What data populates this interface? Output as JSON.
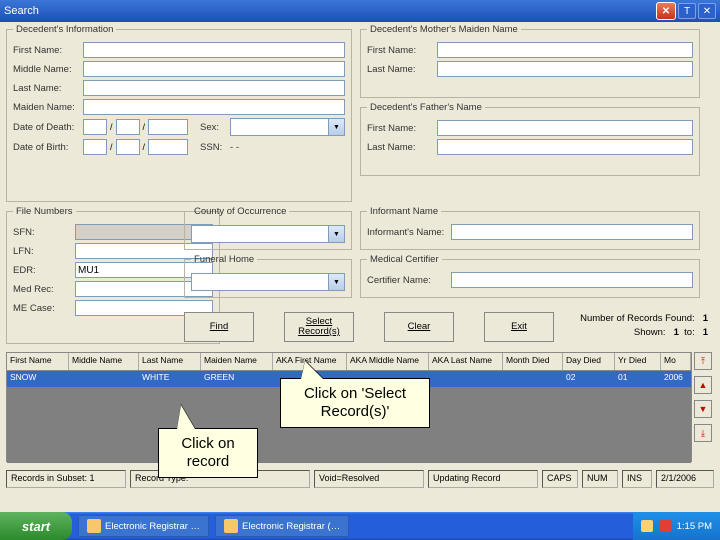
{
  "window": {
    "title": "Search"
  },
  "decedent": {
    "legend": "Decedent's Information",
    "first": "First Name:",
    "middle": "Middle Name:",
    "last": "Last Name:",
    "maiden": "Maiden Name:",
    "dod": "Date of Death:",
    "dob": "Date of Birth:",
    "sex": "Sex:",
    "ssn": "SSN:",
    "ssn_sep": "- -"
  },
  "mother": {
    "legend": "Decedent's Mother's Maiden Name",
    "first": "First Name:",
    "last": "Last Name:"
  },
  "father": {
    "legend": "Decedent's Father's Name",
    "first": "First Name:",
    "last": "Last Name:"
  },
  "filenum": {
    "legend": "File Numbers",
    "sfn": "SFN:",
    "lfn": "LFN:",
    "edr": "EDR:",
    "edr_val": "MU1",
    "medrec": "Med Rec:",
    "mecase": "ME Case:"
  },
  "county": {
    "legend": "County of Occurrence"
  },
  "funeral": {
    "legend": "Funeral Home"
  },
  "informant": {
    "legend": "Informant Name",
    "label": "Informant's Name:"
  },
  "medical": {
    "legend": "Medical Certifier",
    "label": "Certifier Name:"
  },
  "buttons": {
    "find": "Find",
    "select": "Select Record(s)",
    "clear": "Clear",
    "exit": "Exit"
  },
  "stats": {
    "found_lbl": "Number of Records Found:",
    "found": "1",
    "shown_lbl": "Shown:",
    "shown_from": "1",
    "to_lbl": "to:",
    "shown_to": "1"
  },
  "grid": {
    "headers": [
      "First Name",
      "Middle Name",
      "Last Name",
      "Maiden Name",
      "AKA First Name",
      "AKA Middle Name",
      "AKA Last Name",
      "Month Died",
      "Day Died",
      "Yr Died",
      "Mo"
    ],
    "row": [
      "SNOW",
      "",
      "WHITE",
      "GREEN",
      "",
      "",
      "",
      "",
      "02",
      "01",
      "2006"
    ]
  },
  "status": {
    "cell1": "Records in Subset: 1",
    "cell2": "Record Type:",
    "cell3": "Void=Resolved",
    "cell4": "Updating Record",
    "caps": "CAPS",
    "num": "NUM",
    "ins": "INS",
    "date": "2/1/2006"
  },
  "callouts": {
    "selectrec": "Click on 'Select Record(s)'",
    "record": "Click on record"
  },
  "taskbar": {
    "start": "start",
    "task1": "Electronic Registrar …",
    "task2": "Electronic Registrar (…",
    "time": "1:15 PM"
  }
}
